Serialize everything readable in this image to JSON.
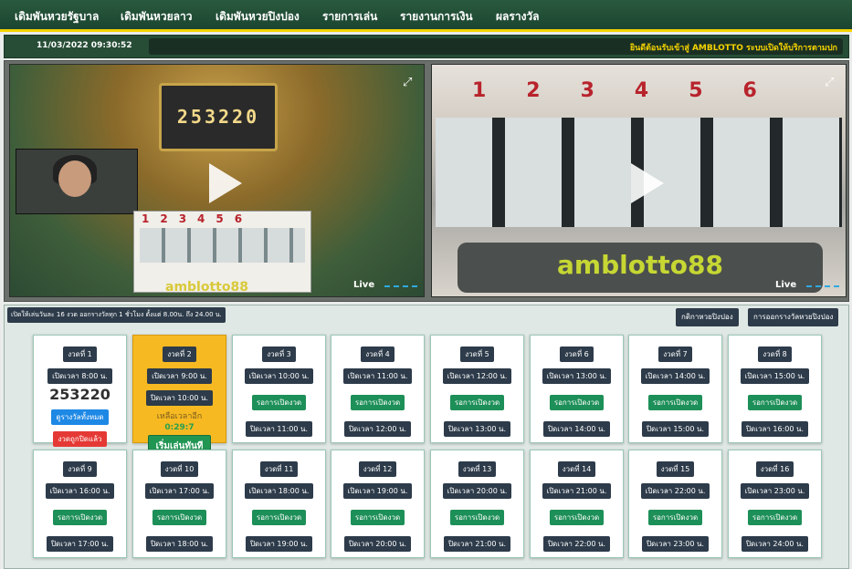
{
  "nav": {
    "items": [
      "เดิมพันหวยรัฐบาล",
      "เดิมพันหวยลาว",
      "เดิมพันหวยปิงปอง",
      "รายการเล่น",
      "รายงานการเงิน",
      "ผลรางวัล"
    ]
  },
  "infobar": {
    "datetime": "11/03/2022 09:30:52",
    "marquee": "ยินดีต้อนรับเข้าสู่ AMBLOTTO ระบบเปิดให้บริการตามปก"
  },
  "videos": {
    "left": {
      "scoreboard": "253220",
      "machine_numbers": "123456",
      "brand": "amblotto88",
      "live": "Live"
    },
    "right": {
      "machine_numbers": "123456",
      "brand": "amblotto88",
      "live": "Live"
    }
  },
  "strip": {
    "notice": "เปิดให้เล่นวันละ 16 งวด ออกรางวัลทุก 1 ชั่วโมง ตั้งแต่ 8.00น. ถึง 24.00 น.",
    "rules_button": "กติกาหวยปิงปอง",
    "schedule_button": "การออกรางวัลหวยปิงปอง"
  },
  "rounds": [
    {
      "title": "งวดที่ 1",
      "open": "เปิดเวลา 8:00 น.",
      "result": "253220",
      "all_results": "ดูรางวัลทั้งหมด",
      "closed": "งวดถูกปิดแล้ว"
    },
    {
      "title": "งวดที่ 2",
      "open": "เปิดเวลา 9:00 น.",
      "close": "ปิดเวลา 10:00 น.",
      "remain": "เหลือเวลาอีก",
      "countdown": "0:29:7",
      "play": "เริ่มเล่นทันที"
    },
    {
      "title": "งวดที่ 3",
      "open": "เปิดเวลา 10:00 น.",
      "waiting": "รอการเปิดงวด",
      "close": "ปิดเวลา 11:00 น."
    },
    {
      "title": "งวดที่ 4",
      "open": "เปิดเวลา 11:00 น.",
      "waiting": "รอการเปิดงวด",
      "close": "ปิดเวลา 12:00 น."
    },
    {
      "title": "งวดที่ 5",
      "open": "เปิดเวลา 12:00 น.",
      "waiting": "รอการเปิดงวด",
      "close": "ปิดเวลา 13:00 น."
    },
    {
      "title": "งวดที่ 6",
      "open": "เปิดเวลา 13:00 น.",
      "waiting": "รอการเปิดงวด",
      "close": "ปิดเวลา 14:00 น."
    },
    {
      "title": "งวดที่ 7",
      "open": "เปิดเวลา 14:00 น.",
      "waiting": "รอการเปิดงวด",
      "close": "ปิดเวลา 15:00 น."
    },
    {
      "title": "งวดที่ 8",
      "open": "เปิดเวลา 15:00 น.",
      "waiting": "รอการเปิดงวด",
      "close": "ปิดเวลา 16:00 น."
    },
    {
      "title": "งวดที่ 9",
      "open": "เปิดเวลา 16:00 น.",
      "waiting": "รอการเปิดงวด",
      "close": "ปิดเวลา 17:00 น."
    },
    {
      "title": "งวดที่ 10",
      "open": "เปิดเวลา 17:00 น.",
      "waiting": "รอการเปิดงวด",
      "close": "ปิดเวลา 18:00 น."
    },
    {
      "title": "งวดที่ 11",
      "open": "เปิดเวลา 18:00 น.",
      "waiting": "รอการเปิดงวด",
      "close": "ปิดเวลา 19:00 น."
    },
    {
      "title": "งวดที่ 12",
      "open": "เปิดเวลา 19:00 น.",
      "waiting": "รอการเปิดงวด",
      "close": "ปิดเวลา 20:00 น."
    },
    {
      "title": "งวดที่ 13",
      "open": "เปิดเวลา 20:00 น.",
      "waiting": "รอการเปิดงวด",
      "close": "ปิดเวลา 21:00 น."
    },
    {
      "title": "งวดที่ 14",
      "open": "เปิดเวลา 21:00 น.",
      "waiting": "รอการเปิดงวด",
      "close": "ปิดเวลา 22:00 น."
    },
    {
      "title": "งวดที่ 15",
      "open": "เปิดเวลา 22:00 น.",
      "waiting": "รอการเปิดงวด",
      "close": "ปิดเวลา 23:00 น."
    },
    {
      "title": "งวดที่ 16",
      "open": "เปิดเวลา 23:00 น.",
      "waiting": "รอการเปิดงวด",
      "close": "ปิดเวลา 24:00 น."
    }
  ]
}
